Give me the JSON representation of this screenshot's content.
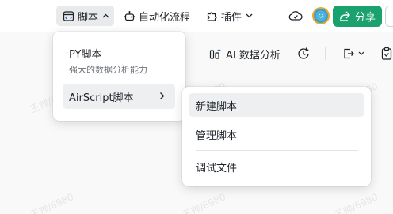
{
  "toolbar": {
    "script_label": "脚本",
    "automation_label": "自动化流程",
    "plugin_label": "插件",
    "share_label": "分享"
  },
  "secondary": {
    "ai_analysis_label": "AI 数据分析"
  },
  "menu_script": {
    "py_title": "PY脚本",
    "py_subtitle": "强大的数据分析能力",
    "airscript_label": "AirScript脚本"
  },
  "submenu_airscript": {
    "items": [
      "新建脚本",
      "管理脚本",
      "调试文件"
    ]
  },
  "watermark_text": "王帅/6980",
  "colors": {
    "accent_green": "#19a16e",
    "avatar_ring": "#f0a531"
  }
}
